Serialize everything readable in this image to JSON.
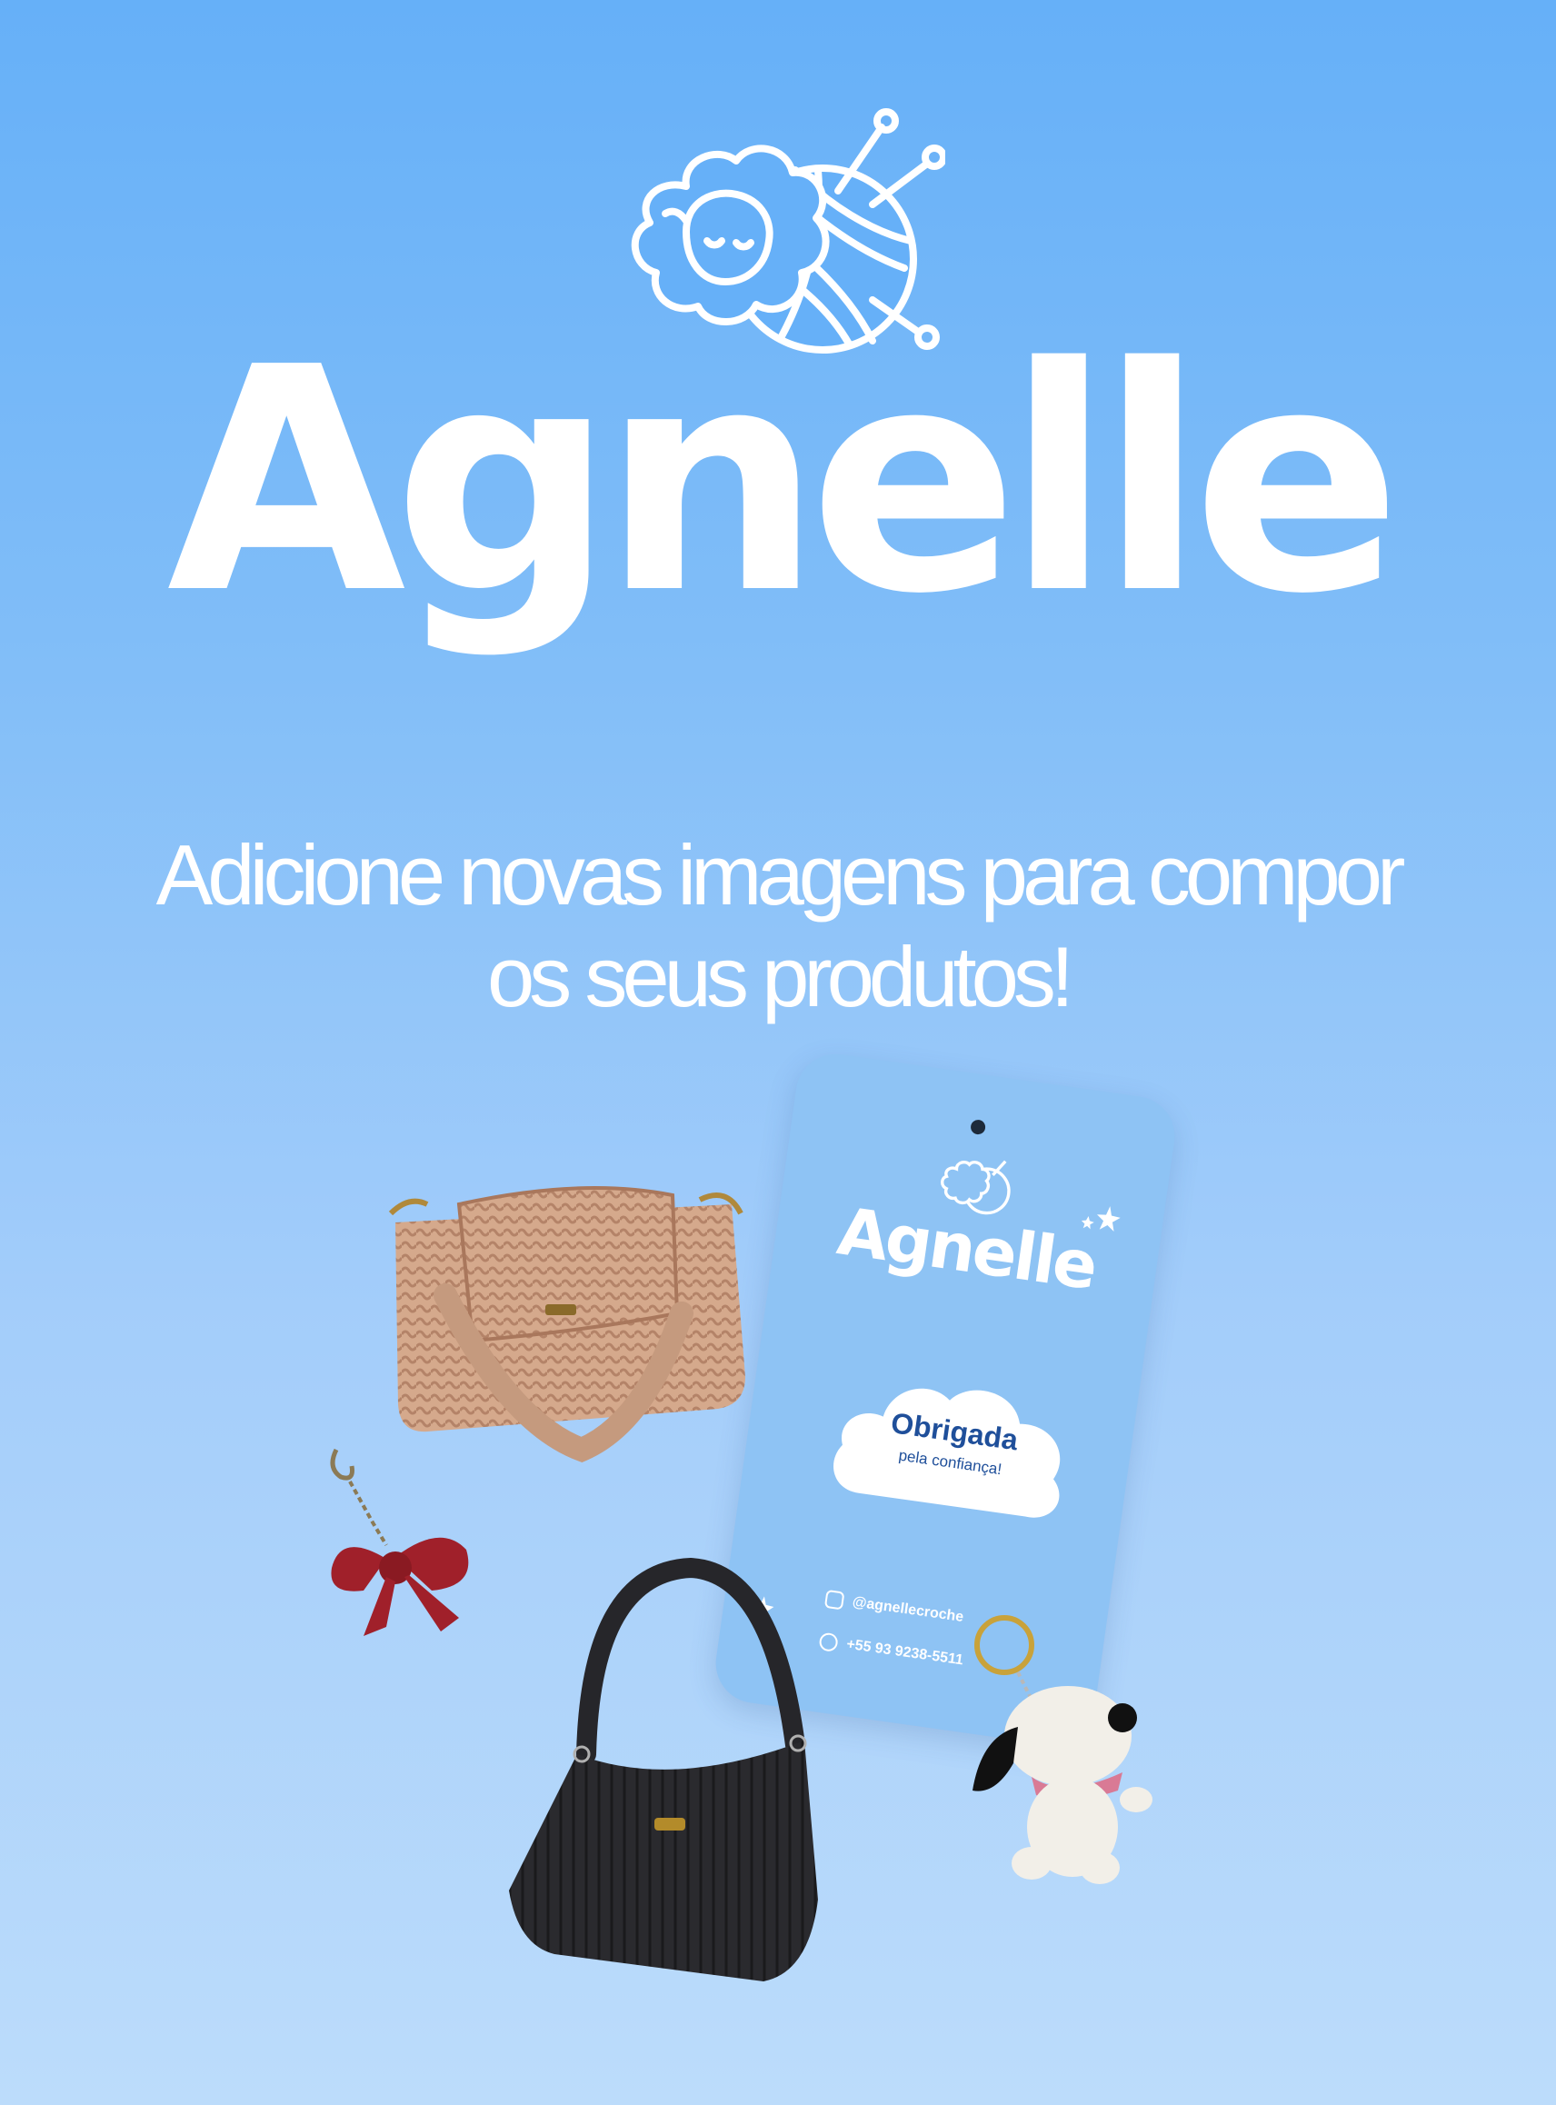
{
  "brand": {
    "wordmark": "Agnelle",
    "logo_icon": "sheep-with-yarn-ball-icon"
  },
  "headline": {
    "line1": "Adicione novas imagens para compor",
    "line2": "os seus produtos!"
  },
  "hang_tag": {
    "wordmark": "Agnelle",
    "thanks": "Obrigada",
    "thanks_sub": "pela confiança!",
    "instagram": "@agnellecroche",
    "whatsapp": "+55 93 9238-5511",
    "icons": [
      "instagram-icon",
      "whatsapp-icon",
      "star-icon"
    ]
  },
  "products": [
    {
      "item": "beige crochet handbag",
      "icon": "beige-handbag-icon"
    },
    {
      "item": "red crochet bow keychain",
      "icon": "bow-keychain-icon"
    },
    {
      "item": "black crochet shoulder bag",
      "icon": "black-shoulder-bag-icon"
    },
    {
      "item": "white dog plush keychain",
      "icon": "dog-keychain-icon"
    }
  ],
  "colors": {
    "background_top": "#66b0f8",
    "background_bottom": "#bcdcfb",
    "text": "#ffffff",
    "tag": "#8ec3f4",
    "tag_accent": "#1f4f9a"
  }
}
